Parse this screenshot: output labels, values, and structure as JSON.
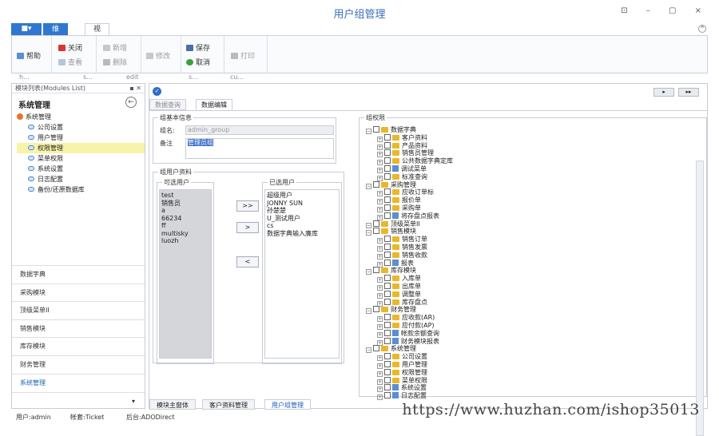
{
  "window": {
    "title": "用户组管理",
    "controls": "⊡ – ▢ ×"
  },
  "ribbon": {
    "file_tab": "■▾",
    "tabs": [
      "维护",
      "视图"
    ],
    "help": "帮助",
    "close": "关闭",
    "view": "查看",
    "add": "新增",
    "delete": "删除",
    "edit": "修改",
    "save": "保存",
    "cancel": "取消",
    "print": "打印",
    "group_labels": [
      "h...",
      "s...",
      "edit",
      "s...",
      "cu..."
    ]
  },
  "modules": {
    "header": "模块列表(Modules List)",
    "title": "系统管理",
    "root": "系统管理",
    "items": [
      "公司设置",
      "用户管理",
      "权限管理",
      "菜单权限",
      "系统设置",
      "日志配置",
      "备份/还原数据库"
    ],
    "selected_index": 2,
    "nav": [
      "数据字典",
      "采购模块",
      "顶级菜单II",
      "销售模块",
      "库存模块",
      "财务管理",
      "系统管理"
    ],
    "active_nav_index": 6
  },
  "tabs": {
    "query": "数据查询",
    "edit": "数据编辑"
  },
  "basic": {
    "caption": "组基本信息",
    "name_label": "组名:",
    "name_value": "admin_group",
    "remark_label": "备注",
    "remark_value": "管理员组"
  },
  "users": {
    "caption": "组用户资料",
    "available_caption": "可选用户",
    "selected_caption": "已选用户",
    "available": [
      "test",
      "销售员",
      "a",
      "66234",
      "ff",
      "multisky",
      "luozh"
    ],
    "selected": [
      "超级用户",
      "JONNY SUN",
      "孙楚楚",
      "U_测试用户",
      "cs",
      "数据字典输入廉库"
    ],
    "btn_add_all": ">>",
    "btn_add": ">",
    "btn_remove": "<"
  },
  "perm": {
    "caption": "组权限",
    "tree": [
      {
        "d": 0,
        "t": "数据字典",
        "folder": true
      },
      {
        "d": 1,
        "t": "客户资料",
        "folder": true
      },
      {
        "d": 1,
        "t": "产品资料",
        "folder": true
      },
      {
        "d": 1,
        "t": "销售员管理",
        "folder": true
      },
      {
        "d": 1,
        "t": "公共数据字典定库",
        "folder": true
      },
      {
        "d": 1,
        "t": "调试菜单",
        "folder": false
      },
      {
        "d": 1,
        "t": "标准查询",
        "folder": true
      },
      {
        "d": 0,
        "t": "采购管理",
        "folder": true
      },
      {
        "d": 1,
        "t": "应收订单标",
        "folder": true
      },
      {
        "d": 1,
        "t": "报价单",
        "folder": true
      },
      {
        "d": 1,
        "t": "采购单",
        "folder": true
      },
      {
        "d": 1,
        "t": "将存盘点报表",
        "folder": false
      },
      {
        "d": 0,
        "t": "顶级菜单II",
        "folder": true
      },
      {
        "d": 0,
        "t": "销售模块",
        "folder": true
      },
      {
        "d": 1,
        "t": "销售订单",
        "folder": true
      },
      {
        "d": 1,
        "t": "销售发票",
        "folder": true
      },
      {
        "d": 1,
        "t": "销售收款",
        "folder": true
      },
      {
        "d": 1,
        "t": "报表",
        "folder": false
      },
      {
        "d": 0,
        "t": "库存模块",
        "folder": true
      },
      {
        "d": 1,
        "t": "入库单",
        "folder": true
      },
      {
        "d": 1,
        "t": "出库单",
        "folder": true
      },
      {
        "d": 1,
        "t": "调整单",
        "folder": true
      },
      {
        "d": 1,
        "t": "库存盘点",
        "folder": true
      },
      {
        "d": 0,
        "t": "财务管理",
        "folder": true
      },
      {
        "d": 1,
        "t": "应收款(AR)",
        "folder": true
      },
      {
        "d": 1,
        "t": "应付款(AP)",
        "folder": true
      },
      {
        "d": 1,
        "t": "帐款余额查询",
        "folder": false
      },
      {
        "d": 1,
        "t": "财务模块报表",
        "folder": false
      },
      {
        "d": 0,
        "t": "系统管理",
        "folder": true
      },
      {
        "d": 1,
        "t": "公司设置",
        "folder": true
      },
      {
        "d": 1,
        "t": "用户管理",
        "folder": true
      },
      {
        "d": 1,
        "t": "权限管理",
        "folder": true
      },
      {
        "d": 1,
        "t": "菜单权限",
        "folder": true
      },
      {
        "d": 1,
        "t": "系统设置",
        "folder": false
      },
      {
        "d": 1,
        "t": "日志配置",
        "folder": false
      }
    ]
  },
  "bottom_tabs": [
    "模块主窗体",
    "客户资料管理",
    "用户组管理"
  ],
  "active_bottom_tab": 2,
  "status": {
    "user": "用户:admin",
    "account": "帐套:Ticket",
    "backend": "后台:ADODirect"
  },
  "watermark": "https://www.huzhan.com/ishop35013",
  "nav_buttons": [
    "▸",
    "▸▸"
  ]
}
